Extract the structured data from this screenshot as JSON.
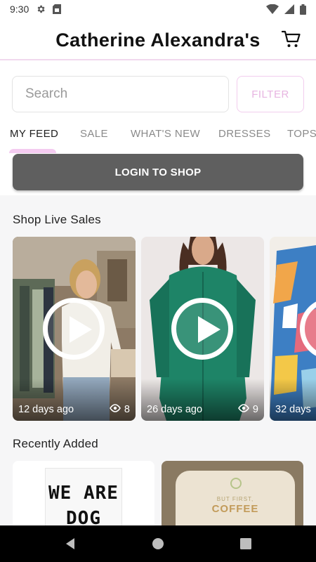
{
  "status_bar": {
    "time": "9:30",
    "left_icons": [
      "gear-icon",
      "sim-card-icon"
    ],
    "right_icons": [
      "wifi-icon",
      "signal-icon",
      "battery-icon"
    ]
  },
  "header": {
    "title": "Catherine Alexandra's",
    "cart_icon": "shopping-cart-icon"
  },
  "search": {
    "placeholder": "Search",
    "value": ""
  },
  "filter": {
    "label": "FILTER"
  },
  "tabs": [
    {
      "label": "MY FEED",
      "active": true
    },
    {
      "label": "SALE",
      "active": false
    },
    {
      "label": "WHAT'S NEW",
      "active": false
    },
    {
      "label": "DRESSES",
      "active": false
    },
    {
      "label": "TOPS",
      "active": false
    }
  ],
  "login": {
    "label": "LOGIN TO SHOP"
  },
  "live_sales": {
    "title": "Shop Live Sales",
    "videos": [
      {
        "age": "12 days ago",
        "views": "8"
      },
      {
        "age": "26 days ago",
        "views": "9"
      },
      {
        "age": "32 days",
        "views": ""
      }
    ]
  },
  "recently_added": {
    "title": "Recently Added",
    "items": [
      {
        "print_lines": [
          "WE ARE",
          "DOG"
        ]
      },
      {
        "print_lines": [
          "BUT FIRST,",
          "COFFEE"
        ]
      }
    ]
  },
  "colors": {
    "accent_pink": "#f1d8ee",
    "filter_text": "#e7b5e1",
    "login_button": "#5f5f5f",
    "content_bg": "#f6f6f7"
  },
  "nav_bar": {
    "icons": [
      "back-icon",
      "home-icon",
      "recents-icon"
    ]
  }
}
